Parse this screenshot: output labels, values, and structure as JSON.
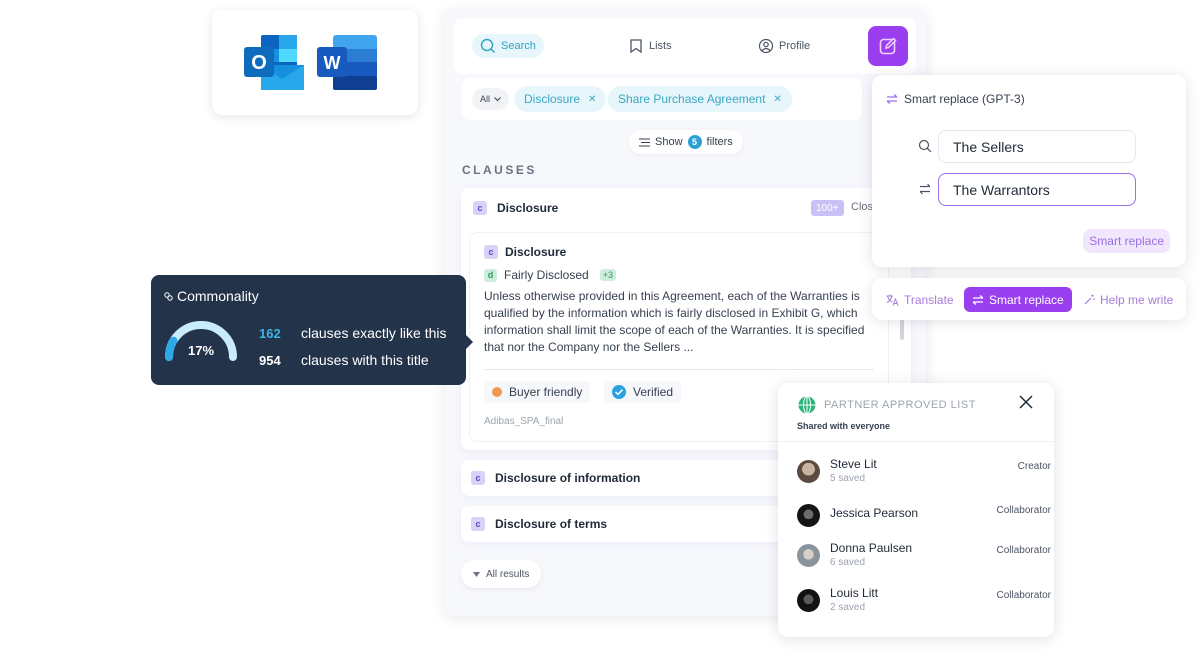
{
  "apps": [
    {
      "name": "Outlook",
      "letter": "O"
    },
    {
      "name": "Word",
      "letter": "W"
    }
  ],
  "nav": {
    "search": "Search",
    "lists": "Lists",
    "profile": "Profile"
  },
  "filters": {
    "scope": "All",
    "chips": [
      "Disclosure",
      "Share Purchase Agreement"
    ],
    "show_prefix": "Show",
    "count": "5",
    "show_suffix": "filters"
  },
  "section_label": "CLAUSES",
  "clause_group": {
    "badge": "c",
    "title": "Disclosure",
    "count": "100+",
    "close_label": "Clos",
    "card": {
      "badge": "c",
      "title": "Disclosure",
      "tag_badge": "d",
      "tag": "Fairly Disclosed",
      "tag_more": "+3",
      "text": "Unless otherwise provided in this Agreement, each of the Warranties is qualified by the information which is fairly disclosed in Exhibit G, which information shall limit the scope of each of the Warranties. It is specified that nor the Company nor the Sellers ...",
      "pills": [
        "Buyer friendly",
        "Verified"
      ],
      "file": "Adibas_SPA_final"
    }
  },
  "clause_rows": [
    {
      "badge": "c",
      "title": "Disclosure of information"
    },
    {
      "badge": "c",
      "title": "Disclosure of terms"
    }
  ],
  "all_results": "All results",
  "commonality": {
    "title": "Commonality",
    "percent_value": 17,
    "percent_label": "17%",
    "stats": [
      {
        "value": "162",
        "label": "clauses exactly like this"
      },
      {
        "value": "954",
        "label": "clauses with this title"
      }
    ]
  },
  "smart_replace": {
    "title": "Smart replace (GPT-3)",
    "find_value": "The Sellers",
    "replace_value": "The Warrantors",
    "button": "Smart replace"
  },
  "toolbar": {
    "translate": "Translate",
    "smart_replace": "Smart replace",
    "help": "Help me write"
  },
  "partner_list": {
    "title": "PARTNER APPROVED LIST",
    "subtitle": "Shared with everyone",
    "members": [
      {
        "name": "Steve Lit",
        "saved": "5 saved",
        "role": "Creator"
      },
      {
        "name": "Jessica Pearson",
        "saved": "",
        "role": "Collaborator"
      },
      {
        "name": "Donna Paulsen",
        "saved": "6 saved",
        "role": "Collaborator"
      },
      {
        "name": "Louis Litt",
        "saved": "2 saved",
        "role": "Collaborator"
      }
    ]
  },
  "colors": {
    "accent_purple": "#9a3ff0",
    "accent_cyan": "#2fa5c0",
    "tooltip_bg": "#233349"
  }
}
